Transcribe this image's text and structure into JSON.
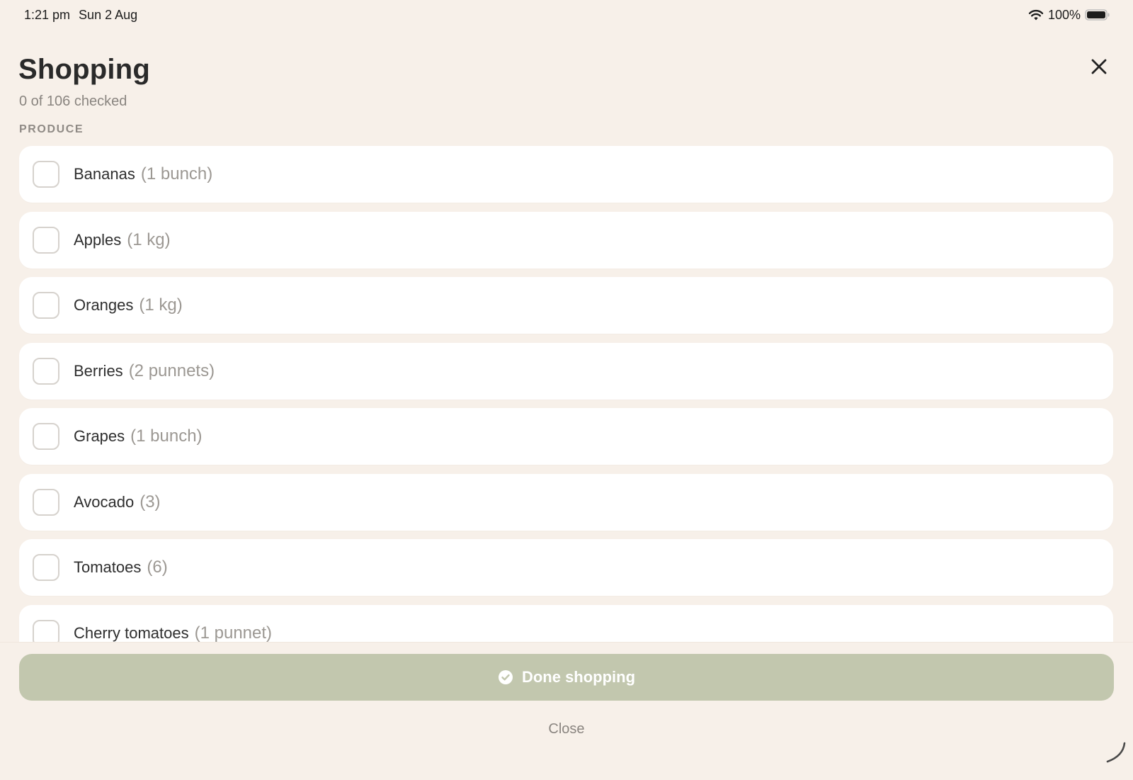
{
  "status_bar": {
    "time": "1:21 pm",
    "date": "Sun 2 Aug",
    "battery": "100%",
    "icons": [
      "wifi-icon",
      "battery-icon"
    ]
  },
  "header": {
    "title": "Shopping",
    "checked_count": "0 of 106 checked",
    "close_icon": "close-icon"
  },
  "sections": [
    {
      "label": "PRODUCE",
      "items": [
        {
          "name": "Bananas",
          "qty": "(1 bunch)"
        },
        {
          "name": "Apples",
          "qty": "(1 kg)"
        },
        {
          "name": "Oranges",
          "qty": "(1 kg)"
        },
        {
          "name": "Berries",
          "qty": "(2 punnets)"
        },
        {
          "name": "Grapes",
          "qty": "(1 bunch)"
        },
        {
          "name": "Avocado",
          "qty": "(3)"
        },
        {
          "name": "Tomatoes",
          "qty": "(6)"
        },
        {
          "name": "Cherry tomatoes",
          "qty": "(1 punnet)"
        }
      ]
    }
  ],
  "footer": {
    "done_label": "Done shopping",
    "close_label": "Close"
  },
  "colors": {
    "background": "#f7f0e9",
    "card": "#ffffff",
    "done_button": "#c2c7ae",
    "muted_text": "#8a8580"
  }
}
